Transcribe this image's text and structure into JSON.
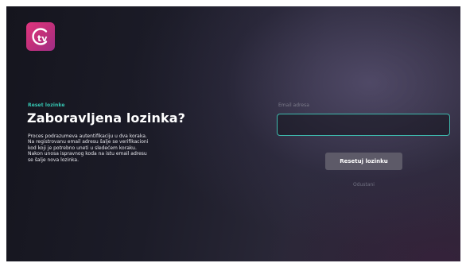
{
  "brand": {
    "logo_icon": "tv-logo-icon",
    "logo_text": "tv",
    "logo_color": "#d6327e"
  },
  "reset": {
    "kicker": "Reset lozinke",
    "title": "Zaboravljena lozinka?",
    "description_lines": [
      "Proces podrazumeva autentifikaciju u dva koraka.",
      "Na registrovanu email adresu šalje se verifikacioni",
      "kod koji je potrebno uneti u sledećem koraku.",
      "Nakon unosa ispravnog koda na istu email adresu",
      "se šalje nova lozinka."
    ],
    "email_label": "Email adresa",
    "email_value": "",
    "reset_button_label": "Resetuj lozinku",
    "cancel_label": "Odustani"
  },
  "colors": {
    "accent_teal": "#35c7b3",
    "input_border": "#3eb9ad",
    "button_bg": "#5d5a68"
  }
}
